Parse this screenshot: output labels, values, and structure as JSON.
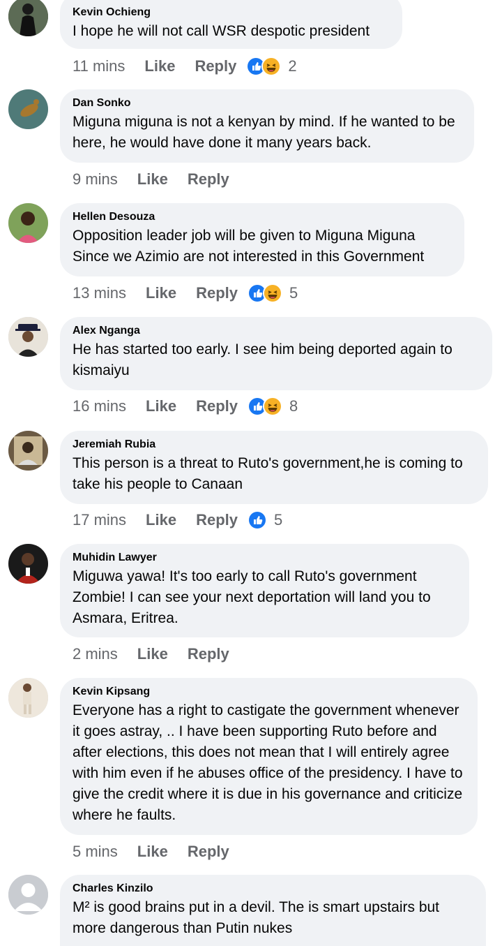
{
  "comments": [
    {
      "author": "Kevin Ochieng",
      "text": "I hope he will not call WSR despotic president",
      "time": "11 mins",
      "like": "Like",
      "reply": "Reply",
      "reactions": [
        "like",
        "haha"
      ],
      "count": "2",
      "avatar_color": "#3b4a3a"
    },
    {
      "author": "Dan Sonko",
      "text": "Miguna miguna is not a kenyan by mind. If he wanted to be here, he would have done it many years back.",
      "time": "9 mins",
      "like": "Like",
      "reply": "Reply",
      "reactions": [],
      "count": "",
      "avatar_color": "#4f7a78"
    },
    {
      "author": "Hellen Desouza",
      "text": "Opposition leader job will be given to Miguna Miguna Since we Azimio are not interested in this Government",
      "time": "13 mins",
      "like": "Like",
      "reply": "Reply",
      "reactions": [
        "like",
        "haha"
      ],
      "count": "5",
      "avatar_color": "#6a8f4a"
    },
    {
      "author": "Alex Nganga",
      "text": "He has started too early. I see him being deported again to kismaiyu",
      "time": "16 mins",
      "like": "Like",
      "reply": "Reply",
      "reactions": [
        "like",
        "haha"
      ],
      "count": "8",
      "avatar_color": "#2b2f45"
    },
    {
      "author": "Jeremiah Rubia",
      "text": "This person is a threat to Ruto's government,he is coming to take his people to Canaan",
      "time": "17 mins",
      "like": "Like",
      "reply": "Reply",
      "reactions": [
        "like"
      ],
      "count": "5",
      "avatar_color": "#6b5a44"
    },
    {
      "author": "Muhidin Lawyer",
      "text": "Miguwa yawa! It's too early to call Ruto's government Zombie! I can see your next deportation will land you to Asmara, Eritrea.",
      "time": "2 mins",
      "like": "Like",
      "reply": "Reply",
      "reactions": [],
      "count": "",
      "avatar_color": "#8e1d18"
    },
    {
      "author": "Kevin Kipsang",
      "text": "Everyone has a right to castigate the government whenever it goes astray, .. I have been supporting Ruto before and after elections, this does not mean that I will entirely agree with him even if he abuses office of the presidency. I have to give the credit where it is due in his governance and criticize where he faults.",
      "time": "5 mins",
      "like": "Like",
      "reply": "Reply",
      "reactions": [],
      "count": "",
      "avatar_color": "#d9cdbb"
    },
    {
      "author": "Charles Kinzilo",
      "text": "M² is good brains put in a  devil. The is smart upstairs but more dangerous than Putin nukes",
      "time": "",
      "like": "",
      "reply": "",
      "reactions": [],
      "count": "",
      "avatar_color": "#c9ccd1"
    }
  ]
}
